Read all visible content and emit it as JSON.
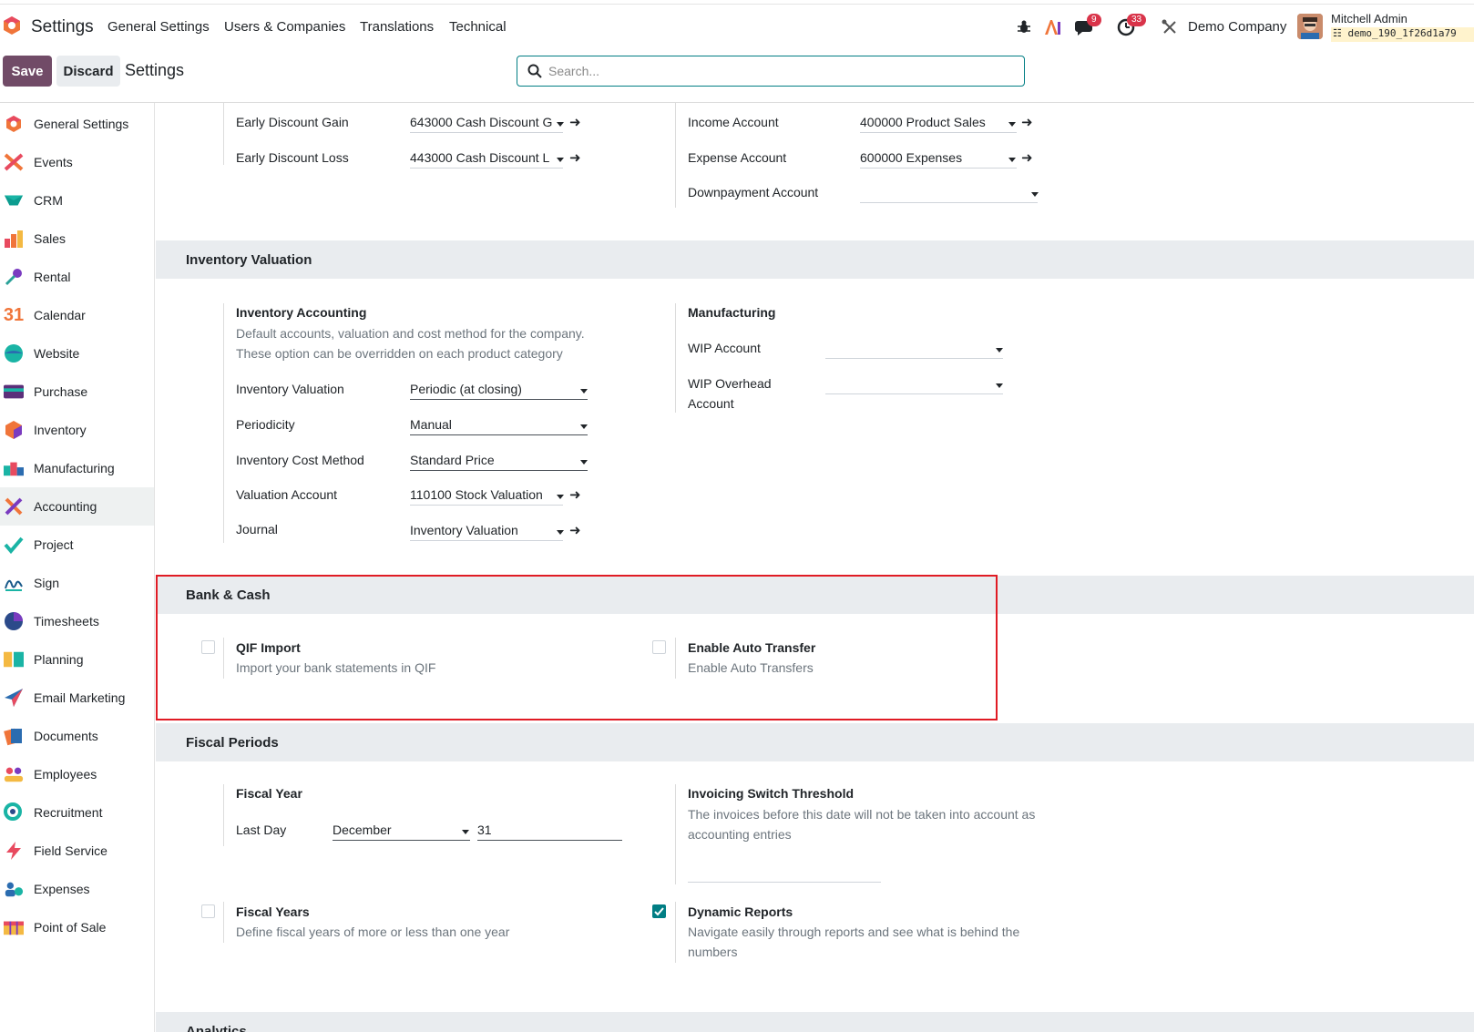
{
  "topnav": {
    "app_title": "Settings",
    "menu": [
      "General Settings",
      "Users & Companies",
      "Translations",
      "Technical"
    ],
    "messages_badge": "9",
    "activity_badge": "33",
    "company": "Demo Company",
    "user_name": "Mitchell Admin",
    "db_name": "demo_190_1f26d1a79"
  },
  "control_panel": {
    "save_label": "Save",
    "discard_label": "Discard",
    "breadcrumb": "Settings",
    "search_placeholder": "Search..."
  },
  "sidebar": {
    "items": [
      {
        "label": "General Settings"
      },
      {
        "label": "Events"
      },
      {
        "label": "CRM"
      },
      {
        "label": "Sales"
      },
      {
        "label": "Rental"
      },
      {
        "label": "Calendar"
      },
      {
        "label": "Website"
      },
      {
        "label": "Purchase"
      },
      {
        "label": "Inventory"
      },
      {
        "label": "Manufacturing"
      },
      {
        "label": "Accounting"
      },
      {
        "label": "Project"
      },
      {
        "label": "Sign"
      },
      {
        "label": "Timesheets"
      },
      {
        "label": "Planning"
      },
      {
        "label": "Email Marketing"
      },
      {
        "label": "Documents"
      },
      {
        "label": "Employees"
      },
      {
        "label": "Recruitment"
      },
      {
        "label": "Field Service"
      },
      {
        "label": "Expenses"
      },
      {
        "label": "Point of Sale"
      }
    ],
    "active": "Accounting",
    "calendar_icon_text": "31"
  },
  "discount": {
    "gain_label": "Early Discount Gain",
    "gain_value": "643000 Cash Discount G",
    "loss_label": "Early Discount Loss",
    "loss_value": "443000 Cash Discount L",
    "income_label": "Income Account",
    "income_value": "400000 Product Sales",
    "expense_label": "Expense Account",
    "expense_value": "600000 Expenses",
    "downpayment_label": "Downpayment Account",
    "downpayment_value": ""
  },
  "inventory_valuation": {
    "title": "Inventory Valuation",
    "accounting_title": "Inventory Accounting",
    "accounting_desc_1": "Default accounts, valuation and cost method for the company.",
    "accounting_desc_2": "These option can be overridden on each product category",
    "valuation_label": "Inventory Valuation",
    "valuation_value": "Periodic (at closing)",
    "periodicity_label": "Periodicity",
    "periodicity_value": "Manual",
    "cost_method_label": "Inventory Cost Method",
    "cost_method_value": "Standard Price",
    "valuation_account_label": "Valuation Account",
    "valuation_account_value": "110100 Stock Valuation",
    "journal_label": "Journal",
    "journal_value": "Inventory Valuation",
    "manufacturing_title": "Manufacturing",
    "wip_label": "WIP Account",
    "wip_overhead_label_1": "WIP Overhead",
    "wip_overhead_label_2": "Account"
  },
  "bank_cash": {
    "title": "Bank & Cash",
    "qif_title": "QIF Import",
    "qif_desc": "Import your bank statements in QIF",
    "auto_transfer_title": "Enable Auto Transfer",
    "auto_transfer_desc": "Enable Auto Transfers"
  },
  "fiscal_periods": {
    "title": "Fiscal Periods",
    "fiscal_year_title": "Fiscal Year",
    "last_day_label": "Last Day",
    "month_value": "December",
    "day_value": "31",
    "threshold_title": "Invoicing Switch Threshold",
    "threshold_desc_1": "The invoices before this date will not be taken into account as",
    "threshold_desc_2": "accounting entries",
    "fiscal_years_title": "Fiscal Years",
    "fiscal_years_desc": "Define fiscal years of more or less than one year",
    "dynamic_title": "Dynamic Reports",
    "dynamic_desc_1": "Navigate easily through reports and see what is behind the",
    "dynamic_desc_2": "numbers"
  },
  "analytics": {
    "title": "Analytics"
  },
  "colors": {
    "brand": "#714b67",
    "accent": "#017e84",
    "highlight": "#e01b24"
  }
}
